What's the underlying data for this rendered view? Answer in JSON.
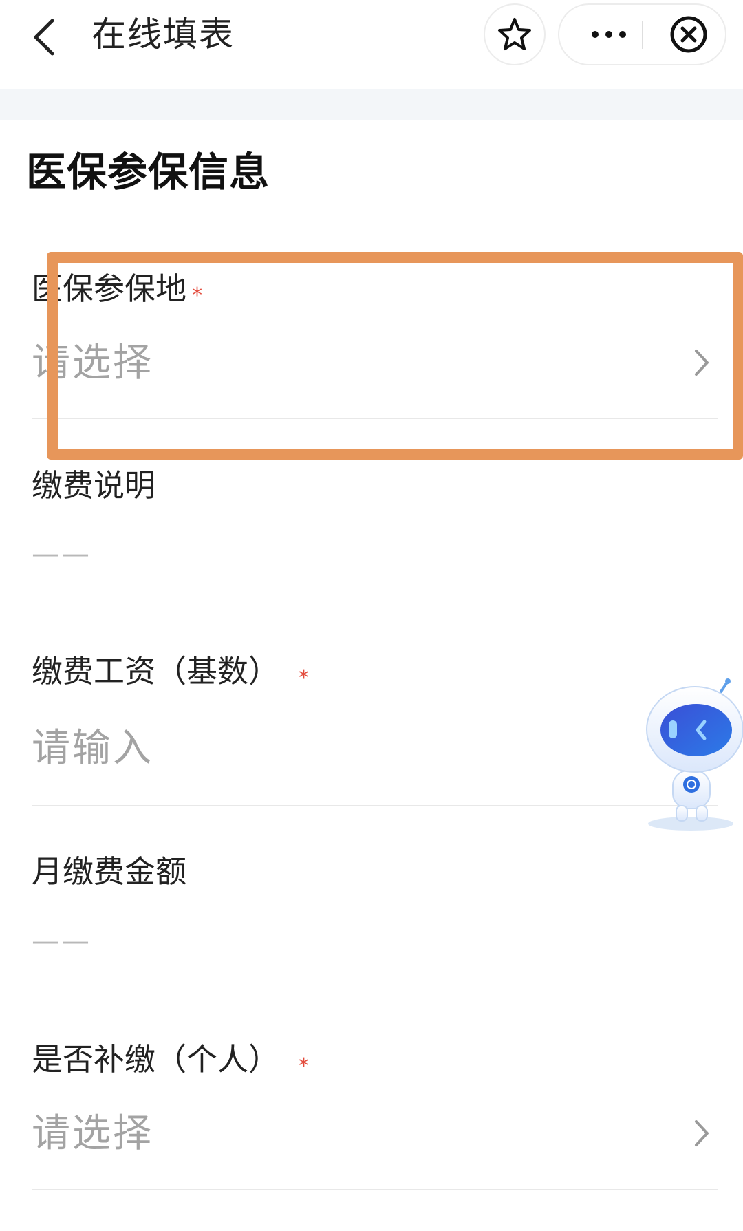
{
  "header": {
    "title": "在线填表"
  },
  "section": {
    "title": "医保参保信息"
  },
  "fields": [
    {
      "label": "医保参保地",
      "required_mark": "*",
      "value": "请选择"
    },
    {
      "label": "缴费说明",
      "value": "——"
    },
    {
      "label": "缴费工资（基数）",
      "required_mark": "*",
      "value": "请输入"
    },
    {
      "label": "月缴费金额",
      "value": "——"
    },
    {
      "label": "是否补缴（个人）",
      "required_mark": "*",
      "value": "请选择"
    }
  ],
  "colors": {
    "highlight": "#e7965a",
    "required": "#e34b3c",
    "placeholder": "#a3a3a3",
    "band": "#f3f6f9"
  },
  "icons": [
    "back-icon",
    "star-icon",
    "more-icon",
    "close-icon",
    "chevron-right-icon",
    "assistant-robot-icon"
  ]
}
